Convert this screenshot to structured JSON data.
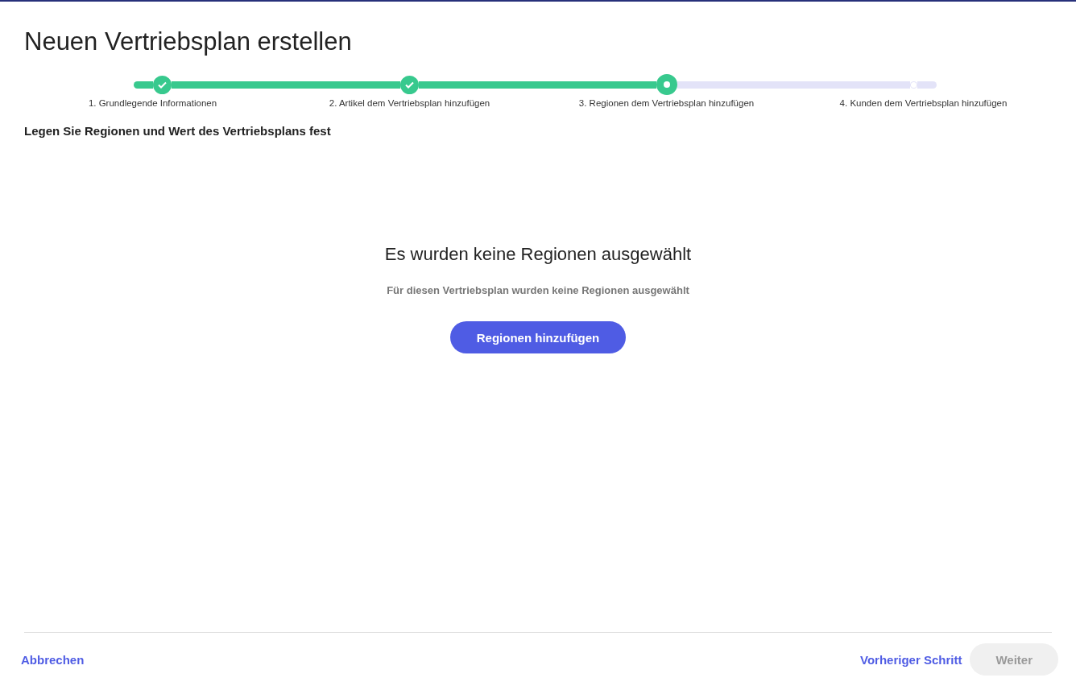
{
  "title": "Neuen Vertriebsplan erstellen",
  "steps": [
    {
      "label": "1. Grundlegende Informationen",
      "completed": true,
      "selected": false
    },
    {
      "label": "2. Artikel dem Vertriebsplan hinzufügen",
      "completed": true,
      "selected": false
    },
    {
      "label": "3. Regionen dem Vertriebsplan hinzufügen",
      "completed": false,
      "selected": true
    },
    {
      "label": "4. Kunden dem Vertriebsplan hinzufügen",
      "completed": false,
      "selected": false
    }
  ],
  "section_heading": "Legen Sie Regionen und Wert des Vertriebsplans fest",
  "empty_state": {
    "title": "Es wurden keine Regionen ausgewählt",
    "message": "Für diesen Vertriebsplan wurden keine Regionen ausgewählt",
    "button": "Regionen hinzufügen"
  },
  "footer": {
    "cancel": "Abbrechen",
    "previous": "Vorheriger Schritt",
    "next": "Weiter",
    "next_disabled": true
  }
}
